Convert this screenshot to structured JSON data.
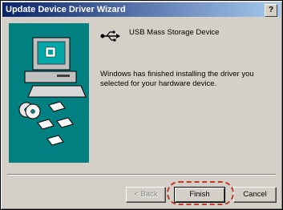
{
  "window": {
    "title": "Update Device Driver Wizard",
    "help_label": "?"
  },
  "device": {
    "name": "USB Mass Storage Device",
    "icon": "usb-icon"
  },
  "message": "Windows has finished installing the driver you selected for your hardware device.",
  "buttons": {
    "back": "< Back",
    "finish": "Finish",
    "cancel": "Cancel"
  },
  "colors": {
    "titlebar_start": "#0a246a",
    "titlebar_end": "#a6caf0",
    "dialog_face": "#d4d0c8",
    "art_background": "#008080",
    "highlight": "#c0392b"
  }
}
